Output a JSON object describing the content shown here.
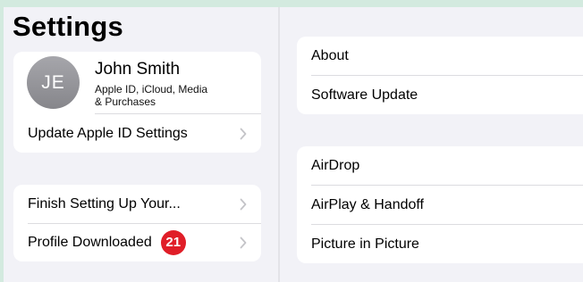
{
  "title": "Settings",
  "profile": {
    "initials": "JE",
    "name": "John Smith",
    "subtitle_line1": "Apple ID, iCloud, Media",
    "subtitle_line2": "& Purchases",
    "update_label": "Update Apple ID Settings"
  },
  "setup_group": {
    "finish_label": "Finish Setting Up Your...",
    "profile_downloaded_label": "Profile Downloaded",
    "profile_downloaded_badge": "21"
  },
  "general_group1": {
    "about_label": "About",
    "software_update_label": "Software Update"
  },
  "general_group2": {
    "airdrop_label": "AirDrop",
    "airplay_label": "AirPlay & Handoff",
    "pip_label": "Picture in Picture"
  },
  "colors": {
    "badge": "#e01e28",
    "chevron": "#c4c4c8",
    "background": "#f2f2f7",
    "frame": "#d3eadf"
  },
  "icons": {
    "disclosure": "chevron-right-icon"
  }
}
